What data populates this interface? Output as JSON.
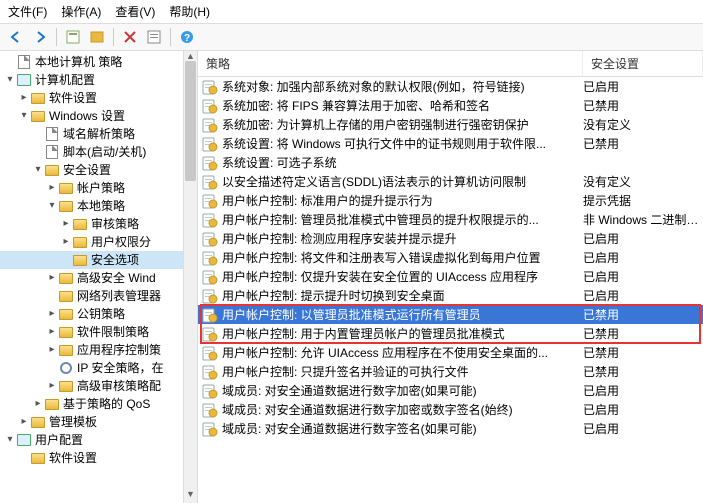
{
  "menu": {
    "file": "文件(F)",
    "action": "操作(A)",
    "view": "查看(V)",
    "help": "帮助(H)"
  },
  "columns": {
    "policy": "策略",
    "security": "安全设置"
  },
  "tree": [
    {
      "depth": 0,
      "exp": "",
      "icon": "page",
      "label": "本地计算机 策略"
    },
    {
      "depth": 0,
      "exp": "▾",
      "icon": "comp",
      "label": "计算机配置"
    },
    {
      "depth": 1,
      "exp": "▸",
      "icon": "folder",
      "label": "软件设置"
    },
    {
      "depth": 1,
      "exp": "▾",
      "icon": "folder",
      "label": "Windows 设置"
    },
    {
      "depth": 2,
      "exp": "",
      "icon": "page",
      "label": "域名解析策略"
    },
    {
      "depth": 2,
      "exp": "",
      "icon": "page",
      "label": "脚本(启动/关机)"
    },
    {
      "depth": 2,
      "exp": "▾",
      "icon": "folder",
      "label": "安全设置"
    },
    {
      "depth": 3,
      "exp": "▸",
      "icon": "folder",
      "label": "帐户策略"
    },
    {
      "depth": 3,
      "exp": "▾",
      "icon": "folder",
      "label": "本地策略"
    },
    {
      "depth": 4,
      "exp": "▸",
      "icon": "folder",
      "label": "审核策略"
    },
    {
      "depth": 4,
      "exp": "▸",
      "icon": "folder",
      "label": "用户权限分"
    },
    {
      "depth": 4,
      "exp": "",
      "icon": "folder",
      "label": "安全选项",
      "sel": true
    },
    {
      "depth": 3,
      "exp": "▸",
      "icon": "folder",
      "label": "高级安全 Wind"
    },
    {
      "depth": 3,
      "exp": "",
      "icon": "folder",
      "label": "网络列表管理器"
    },
    {
      "depth": 3,
      "exp": "▸",
      "icon": "folder",
      "label": "公钥策略"
    },
    {
      "depth": 3,
      "exp": "▸",
      "icon": "folder",
      "label": "软件限制策略"
    },
    {
      "depth": 3,
      "exp": "▸",
      "icon": "folder",
      "label": "应用程序控制策"
    },
    {
      "depth": 3,
      "exp": "",
      "icon": "gear",
      "label": "IP 安全策略，在"
    },
    {
      "depth": 3,
      "exp": "▸",
      "icon": "folder",
      "label": "高级审核策略配"
    },
    {
      "depth": 2,
      "exp": "▸",
      "icon": "folder",
      "label": "基于策略的 QoS"
    },
    {
      "depth": 1,
      "exp": "▸",
      "icon": "folder",
      "label": "管理模板"
    },
    {
      "depth": 0,
      "exp": "▾",
      "icon": "comp",
      "label": "用户配置"
    },
    {
      "depth": 1,
      "exp": "",
      "icon": "folder",
      "label": "软件设置"
    }
  ],
  "policies": [
    {
      "name": "系统对象: 加强内部系统对象的默认权限(例如，符号链接)",
      "value": "已启用"
    },
    {
      "name": "系统加密: 将 FIPS 兼容算法用于加密、哈希和签名",
      "value": "已禁用"
    },
    {
      "name": "系统加密: 为计算机上存储的用户密钥强制进行强密钥保护",
      "value": "没有定义"
    },
    {
      "name": "系统设置: 将 Windows 可执行文件中的证书规则用于软件限...",
      "value": "已禁用"
    },
    {
      "name": "系统设置: 可选子系统",
      "value": ""
    },
    {
      "name": "以安全描述符定义语言(SDDL)语法表示的计算机访问限制",
      "value": "没有定义"
    },
    {
      "name": "用户帐户控制: 标准用户的提升提示行为",
      "value": "提示凭据"
    },
    {
      "name": "用户帐户控制: 管理员批准模式中管理员的提升权限提示的...",
      "value": "非 Windows 二进制文件"
    },
    {
      "name": "用户帐户控制: 检测应用程序安装并提示提升",
      "value": "已启用"
    },
    {
      "name": "用户帐户控制: 将文件和注册表写入错误虚拟化到每用户位置",
      "value": "已启用"
    },
    {
      "name": "用户帐户控制: 仅提升安装在安全位置的 UIAccess 应用程序",
      "value": "已启用"
    },
    {
      "name": "用户帐户控制: 提示提升时切换到安全桌面",
      "value": "已启用"
    }
  ],
  "highlighted": [
    {
      "name": "用户帐户控制: 以管理员批准模式运行所有管理员",
      "value": "已禁用",
      "sel": true
    },
    {
      "name": "用户帐户控制: 用于内置管理员帐户的管理员批准模式",
      "value": "已禁用"
    }
  ],
  "policies_after": [
    {
      "name": "用户帐户控制: 允许 UIAccess 应用程序在不使用安全桌面的...",
      "value": "已禁用"
    },
    {
      "name": "用户帐户控制: 只提升签名并验证的可执行文件",
      "value": "已禁用"
    },
    {
      "name": "域成员: 对安全通道数据进行数字加密(如果可能)",
      "value": "已启用"
    },
    {
      "name": "域成员: 对安全通道数据进行数字加密或数字签名(始终)",
      "value": "已启用"
    },
    {
      "name": "域成员: 对安全通道数据进行数字签名(如果可能)",
      "value": "已启用"
    }
  ]
}
